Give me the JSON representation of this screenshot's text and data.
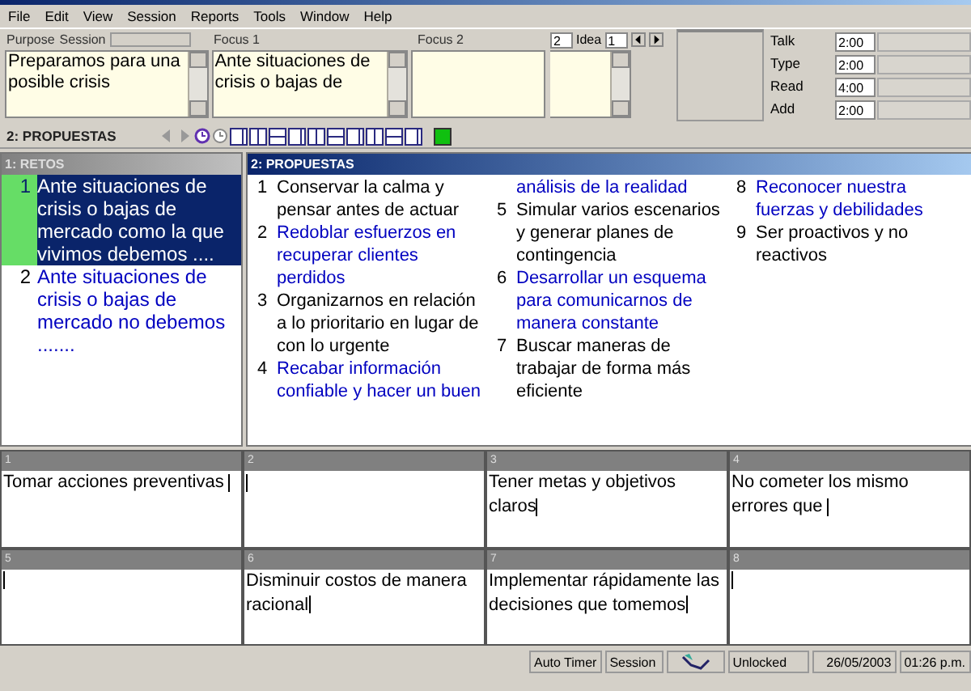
{
  "menu": [
    "File",
    "Edit",
    "View",
    "Session",
    "Reports",
    "Tools",
    "Window",
    "Help"
  ],
  "top": {
    "purpose_label": "Purpose",
    "session_label": "Session",
    "purpose_text": "Preparamos para una posible crisis",
    "focus1_label": "Focus 1",
    "focus1_text": "Ante situaciones de crisis o bajas de",
    "focus2_label": "Focus 2",
    "count": "2",
    "idea_label": "Idea",
    "idea_value": "1"
  },
  "timers": [
    {
      "label": "Talk",
      "value": "2:00"
    },
    {
      "label": "Type",
      "value": "2:00"
    },
    {
      "label": "Read",
      "value": "4:00"
    },
    {
      "label": "Add",
      "value": "2:00"
    }
  ],
  "toolbar": {
    "title": "2: PROPUESTAS"
  },
  "retos": {
    "title": "1: RETOS",
    "items": [
      {
        "number": "1",
        "text": "Ante situaciones de crisis o bajas de mercado como la que vivimos debemos ....",
        "selected": true
      },
      {
        "number": "2",
        "text": "Ante situaciones de crisis o bajas de mercado no debemos .......",
        "selected": false
      }
    ]
  },
  "propuestas": {
    "title": "2: PROPUESTAS",
    "columns": [
      [
        {
          "number": "1",
          "text": "Conservar la calma y pensar antes de actuar",
          "color": "#000000"
        },
        {
          "number": "2",
          "text": "Redoblar esfuerzos en recuperar clientes perdidos",
          "color": "#0000c0"
        },
        {
          "number": "3",
          "text": "Organizarnos en relación a lo prioritario en lugar de con lo urgente",
          "color": "#000000"
        },
        {
          "number": "4",
          "text": "Recabar información confiable y hacer un buen",
          "color": "#0000c0"
        }
      ],
      [
        {
          "text": "análisis de la realidad",
          "color": "#0000c0"
        },
        {
          "number": "5",
          "text": "Simular varios escenarios y generar planes de contingencia",
          "color": "#000000"
        },
        {
          "number": "6",
          "text": "Desarrollar un esquema para comunicarnos de manera constante",
          "color": "#0000c0"
        },
        {
          "number": "7",
          "text": "Buscar maneras de trabajar de forma más eficiente",
          "color": "#000000"
        }
      ],
      [
        {
          "number": "8",
          "text": "Reconocer nuestra fuerzas y debilidades",
          "color": "#0000c0"
        },
        {
          "number": "9",
          "text": "Ser proactivos y no reactivos",
          "color": "#000000"
        }
      ]
    ]
  },
  "cells": [
    {
      "number": "1",
      "text": "Tomar acciones preventivas "
    },
    {
      "number": "2"
    },
    {
      "number": "3",
      "text": "Tener metas y objetivos claros"
    },
    {
      "number": "4",
      "text": "No cometer los mismo errores que "
    },
    {
      "number": "5"
    },
    {
      "number": "6",
      "text": "Disminuir costos de manera racional"
    },
    {
      "number": "7",
      "text": "Implementar rápidamente las decisiones que tomemos"
    },
    {
      "number": "8"
    }
  ],
  "status_bar": {
    "auto_timer": "Auto Timer",
    "session": "Session",
    "lock": "Unlocked",
    "date": "26/05/2003",
    "time": "01:26 p.m."
  }
}
